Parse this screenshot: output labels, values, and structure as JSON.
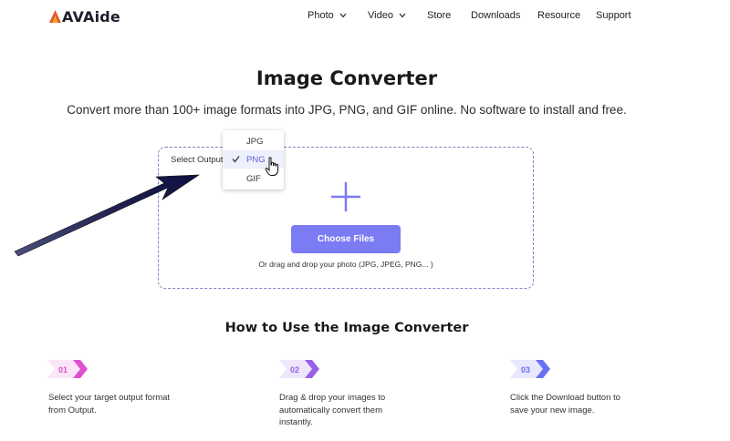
{
  "header": {
    "logo_text": "AVAide",
    "nav": [
      {
        "label": "Photo",
        "has_dropdown": true
      },
      {
        "label": "Video",
        "has_dropdown": true
      },
      {
        "label": "Store",
        "has_dropdown": false
      },
      {
        "label": "Downloads",
        "has_dropdown": false
      },
      {
        "label": "Resource",
        "has_dropdown": false
      },
      {
        "label": "Support",
        "has_dropdown": false
      }
    ]
  },
  "main": {
    "title": "Image Converter",
    "subtitle": "Convert more than 100+ image formats into JPG, PNG, and GIF online. No software to install and free.",
    "upload": {
      "select_label": "Select Output Format",
      "choose_button": "Choose Files",
      "drag_text": "Or drag and drop your photo (JPG, JPEG, PNG... )"
    },
    "dropdown": {
      "options": [
        "JPG",
        "PNG",
        "GIF"
      ],
      "selected": "PNG"
    }
  },
  "howto": {
    "title": "How to Use the Image Converter",
    "steps": [
      {
        "num": "01",
        "text_lines": [
          "Select your target output format",
          "from Output."
        ],
        "color": "#e04fcf"
      },
      {
        "num": "02",
        "text_lines": [
          "Drag & drop your images to",
          "automatically convert them",
          "instantly."
        ],
        "color": "#9a5fe8"
      },
      {
        "num": "03",
        "text_lines": [
          "Click the Download button to",
          "save your new image."
        ],
        "color": "#6a6ff3"
      }
    ]
  },
  "colors": {
    "accent": "#7b7bf4",
    "box_border": "#7d84c7",
    "arrow": "#1e1f4f"
  }
}
